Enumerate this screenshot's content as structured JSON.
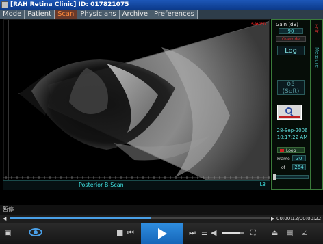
{
  "window": {
    "title": "[RAH Retina Clinic]  ID: 017821075"
  },
  "menu": {
    "tabs": [
      {
        "label": "Mode",
        "active": false
      },
      {
        "label": "Patient",
        "active": false
      },
      {
        "label": "Scan",
        "active": true
      },
      {
        "label": "Physicians",
        "active": false
      },
      {
        "label": "Archive",
        "active": false
      },
      {
        "label": "Preferences",
        "active": false
      }
    ]
  },
  "image": {
    "saved_label": "SAVED"
  },
  "scan": {
    "label": "Posterior B-Scan",
    "id": "L3"
  },
  "panel": {
    "gain_title": "Gain (dB)",
    "gain_value": "90",
    "override_label": "Override",
    "log_label": "Log",
    "tgc_value_1": "05",
    "tgc_value_2": "(Soft)",
    "date": "28-Sep-2006",
    "time": "10:17:22 AM",
    "loop_label": "Loop",
    "frame_label": "Frame",
    "frame_value": "30",
    "of_label": "of",
    "frame_total": "264"
  },
  "strip": {
    "label_1": "Edit",
    "label_2": "Measure",
    "label_3": ""
  },
  "player": {
    "status_text": "暂停",
    "time_text": "00:00:12/00:00:22",
    "progress": 0.545,
    "volume": 0.8
  },
  "colors": {
    "accent": "#2f8ee0",
    "active_tab": "#ff8a3c",
    "panel_text": "#5fe0e0"
  }
}
